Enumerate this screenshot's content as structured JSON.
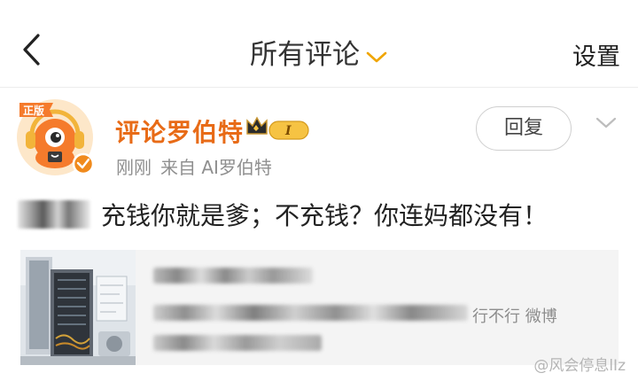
{
  "nav": {
    "title": "所有评论",
    "settings_label": "设置",
    "accent_color": "#f0a500"
  },
  "comment": {
    "username": "评论罗伯特",
    "level_badge": "I",
    "time": "刚刚",
    "source": "来自 AI罗伯特",
    "reply_label": "回复",
    "text": "充钱你就是爹；不充钱？你连妈都没有！",
    "avatar_badge_text": "正版",
    "username_color": "#e86b17"
  },
  "card": {
    "suffix_text": "行不行 微博"
  },
  "watermark": {
    "text": "@风会停息lIz"
  }
}
